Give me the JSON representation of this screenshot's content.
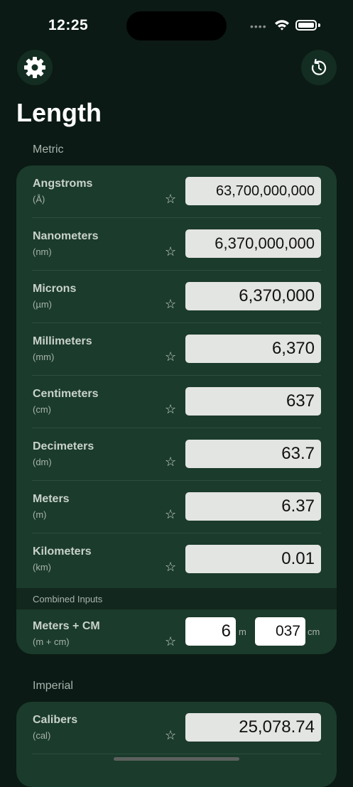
{
  "status": {
    "time": "12:25",
    "signal": "••••"
  },
  "header": {
    "title": "Length"
  },
  "sections": [
    {
      "label": "Metric",
      "rows": [
        {
          "name": "Angstroms",
          "abbr": "(Å)",
          "value": "63,700,000,000"
        },
        {
          "name": "Nanometers",
          "abbr": "(nm)",
          "value": "6,370,000,000"
        },
        {
          "name": "Microns",
          "abbr": "(µm)",
          "value": "6,370,000"
        },
        {
          "name": "Millimeters",
          "abbr": "(mm)",
          "value": "6,370"
        },
        {
          "name": "Centimeters",
          "abbr": "(cm)",
          "value": "637"
        },
        {
          "name": "Decimeters",
          "abbr": "(dm)",
          "value": "63.7"
        },
        {
          "name": "Meters",
          "abbr": "(m)",
          "value": "6.37"
        },
        {
          "name": "Kilometers",
          "abbr": "(km)",
          "value": "0.01"
        }
      ],
      "combined": {
        "header": "Combined Inputs",
        "name": "Meters + CM",
        "abbr": "(m + cm)",
        "meters_value": "6",
        "meters_unit": "m",
        "cm_value": "037",
        "cm_unit": "cm"
      }
    },
    {
      "label": "Imperial",
      "rows": [
        {
          "name": "Calibers",
          "abbr": "(cal)",
          "value": "25,078.74"
        }
      ]
    }
  ],
  "icons": {
    "settings": "gear-icon",
    "reset": "reset-icon",
    "favorite": "star-outline-icon"
  },
  "colors": {
    "background": "#0b1a14",
    "card": "#1b3b2c",
    "field": "#e3e5e2"
  },
  "star_glyph": "☆"
}
